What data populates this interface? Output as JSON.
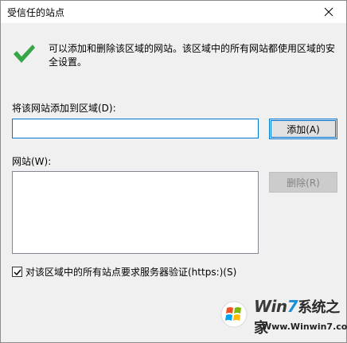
{
  "window": {
    "title": "受信任的站点"
  },
  "info": {
    "text": "可以添加和删除该区域的网站。该区域中的所有网站都使用区域的安全设置。"
  },
  "add_site": {
    "label": "将该网站添加到区域(D):",
    "value": "",
    "button_label": "添加(A)"
  },
  "sites": {
    "label": "网站(W):",
    "items": [],
    "remove_label": "删除(R)"
  },
  "https_checkbox": {
    "label": "对该区域中的所有站点要求服务器验证(https:)(S)",
    "checked": true
  },
  "watermark": {
    "brand_prefix": "Win",
    "brand_seven": "7",
    "brand_suffix": "系统之家",
    "url": "Www.Winwin7.com"
  },
  "colors": {
    "accent": "#0078d7",
    "check_green": "#37a647"
  }
}
